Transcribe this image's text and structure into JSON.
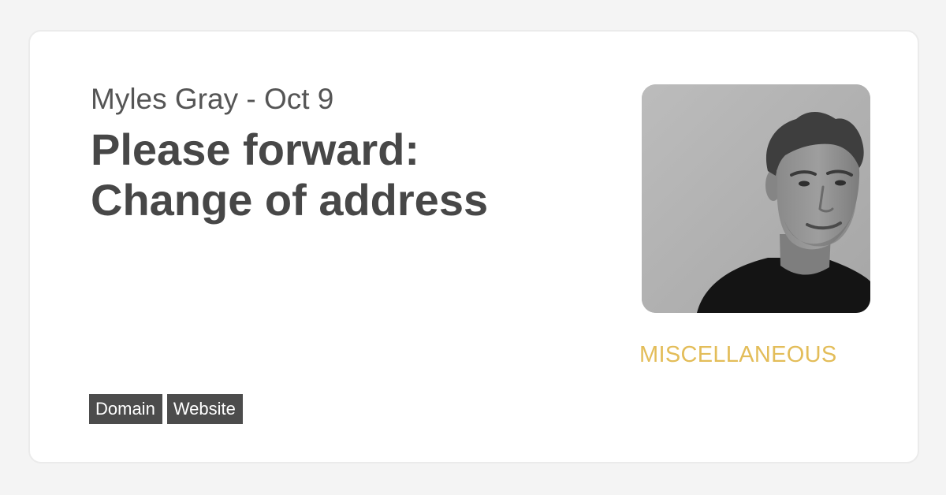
{
  "post": {
    "author": "Myles Gray",
    "date": "Oct 9",
    "byline": "Myles Gray - Oct 9",
    "title_line1": "Please forward:",
    "title_line2": "Change of address",
    "category": "MISCELLANEOUS",
    "tags": [
      "Domain",
      "Website"
    ]
  },
  "avatar": {
    "icon": "author-portrait-photo"
  },
  "colors": {
    "page_background": "#f4f4f4",
    "card_background": "#ffffff",
    "text_primary": "#474747",
    "byline_text": "#555555",
    "tag_background": "#4c4c4c",
    "tag_text": "#ffffff",
    "category_accent": "#e3bd59"
  }
}
